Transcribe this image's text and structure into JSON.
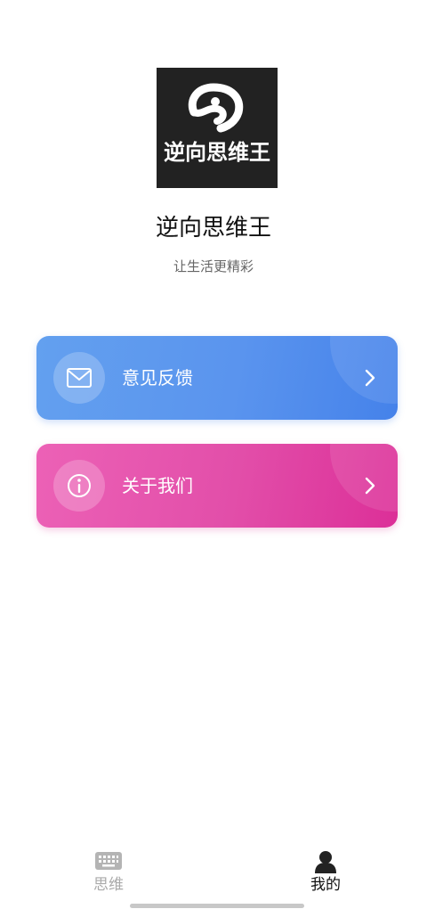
{
  "app": {
    "logo_text": "逆向思维王",
    "title": "逆向思维王",
    "slogan": "让生活更精彩"
  },
  "menu": [
    {
      "label": "意见反馈",
      "icon": "mail-icon",
      "gradient": [
        "#63a0ef",
        "#4582ea"
      ]
    },
    {
      "label": "关于我们",
      "icon": "info-icon",
      "gradient": [
        "#ec61b6",
        "#dc2f98"
      ]
    }
  ],
  "tabbar": {
    "tabs": [
      {
        "label": "思维",
        "icon": "keyboard-icon",
        "active": false
      },
      {
        "label": "我的",
        "icon": "person-icon",
        "active": true
      }
    ],
    "active_color": "#111111",
    "inactive_color": "#aaaaaa"
  }
}
